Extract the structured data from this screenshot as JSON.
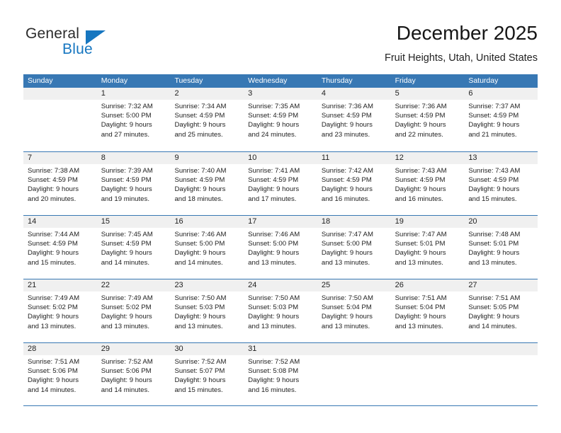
{
  "brand": {
    "name_part1": "General",
    "name_part2": "Blue",
    "accent_color": "#1676c0"
  },
  "header": {
    "title": "December 2025",
    "subtitle": "Fruit Heights, Utah, United States"
  },
  "calendar": {
    "header_color": "#3878b4",
    "weekdays": [
      "Sunday",
      "Monday",
      "Tuesday",
      "Wednesday",
      "Thursday",
      "Friday",
      "Saturday"
    ],
    "weeks": [
      [
        {
          "day": "",
          "sunrise": "",
          "sunset": "",
          "daylight1": "",
          "daylight2": ""
        },
        {
          "day": "1",
          "sunrise": "Sunrise: 7:32 AM",
          "sunset": "Sunset: 5:00 PM",
          "daylight1": "Daylight: 9 hours",
          "daylight2": "and 27 minutes."
        },
        {
          "day": "2",
          "sunrise": "Sunrise: 7:34 AM",
          "sunset": "Sunset: 4:59 PM",
          "daylight1": "Daylight: 9 hours",
          "daylight2": "and 25 minutes."
        },
        {
          "day": "3",
          "sunrise": "Sunrise: 7:35 AM",
          "sunset": "Sunset: 4:59 PM",
          "daylight1": "Daylight: 9 hours",
          "daylight2": "and 24 minutes."
        },
        {
          "day": "4",
          "sunrise": "Sunrise: 7:36 AM",
          "sunset": "Sunset: 4:59 PM",
          "daylight1": "Daylight: 9 hours",
          "daylight2": "and 23 minutes."
        },
        {
          "day": "5",
          "sunrise": "Sunrise: 7:36 AM",
          "sunset": "Sunset: 4:59 PM",
          "daylight1": "Daylight: 9 hours",
          "daylight2": "and 22 minutes."
        },
        {
          "day": "6",
          "sunrise": "Sunrise: 7:37 AM",
          "sunset": "Sunset: 4:59 PM",
          "daylight1": "Daylight: 9 hours",
          "daylight2": "and 21 minutes."
        }
      ],
      [
        {
          "day": "7",
          "sunrise": "Sunrise: 7:38 AM",
          "sunset": "Sunset: 4:59 PM",
          "daylight1": "Daylight: 9 hours",
          "daylight2": "and 20 minutes."
        },
        {
          "day": "8",
          "sunrise": "Sunrise: 7:39 AM",
          "sunset": "Sunset: 4:59 PM",
          "daylight1": "Daylight: 9 hours",
          "daylight2": "and 19 minutes."
        },
        {
          "day": "9",
          "sunrise": "Sunrise: 7:40 AM",
          "sunset": "Sunset: 4:59 PM",
          "daylight1": "Daylight: 9 hours",
          "daylight2": "and 18 minutes."
        },
        {
          "day": "10",
          "sunrise": "Sunrise: 7:41 AM",
          "sunset": "Sunset: 4:59 PM",
          "daylight1": "Daylight: 9 hours",
          "daylight2": "and 17 minutes."
        },
        {
          "day": "11",
          "sunrise": "Sunrise: 7:42 AM",
          "sunset": "Sunset: 4:59 PM",
          "daylight1": "Daylight: 9 hours",
          "daylight2": "and 16 minutes."
        },
        {
          "day": "12",
          "sunrise": "Sunrise: 7:43 AM",
          "sunset": "Sunset: 4:59 PM",
          "daylight1": "Daylight: 9 hours",
          "daylight2": "and 16 minutes."
        },
        {
          "day": "13",
          "sunrise": "Sunrise: 7:43 AM",
          "sunset": "Sunset: 4:59 PM",
          "daylight1": "Daylight: 9 hours",
          "daylight2": "and 15 minutes."
        }
      ],
      [
        {
          "day": "14",
          "sunrise": "Sunrise: 7:44 AM",
          "sunset": "Sunset: 4:59 PM",
          "daylight1": "Daylight: 9 hours",
          "daylight2": "and 15 minutes."
        },
        {
          "day": "15",
          "sunrise": "Sunrise: 7:45 AM",
          "sunset": "Sunset: 4:59 PM",
          "daylight1": "Daylight: 9 hours",
          "daylight2": "and 14 minutes."
        },
        {
          "day": "16",
          "sunrise": "Sunrise: 7:46 AM",
          "sunset": "Sunset: 5:00 PM",
          "daylight1": "Daylight: 9 hours",
          "daylight2": "and 14 minutes."
        },
        {
          "day": "17",
          "sunrise": "Sunrise: 7:46 AM",
          "sunset": "Sunset: 5:00 PM",
          "daylight1": "Daylight: 9 hours",
          "daylight2": "and 13 minutes."
        },
        {
          "day": "18",
          "sunrise": "Sunrise: 7:47 AM",
          "sunset": "Sunset: 5:00 PM",
          "daylight1": "Daylight: 9 hours",
          "daylight2": "and 13 minutes."
        },
        {
          "day": "19",
          "sunrise": "Sunrise: 7:47 AM",
          "sunset": "Sunset: 5:01 PM",
          "daylight1": "Daylight: 9 hours",
          "daylight2": "and 13 minutes."
        },
        {
          "day": "20",
          "sunrise": "Sunrise: 7:48 AM",
          "sunset": "Sunset: 5:01 PM",
          "daylight1": "Daylight: 9 hours",
          "daylight2": "and 13 minutes."
        }
      ],
      [
        {
          "day": "21",
          "sunrise": "Sunrise: 7:49 AM",
          "sunset": "Sunset: 5:02 PM",
          "daylight1": "Daylight: 9 hours",
          "daylight2": "and 13 minutes."
        },
        {
          "day": "22",
          "sunrise": "Sunrise: 7:49 AM",
          "sunset": "Sunset: 5:02 PM",
          "daylight1": "Daylight: 9 hours",
          "daylight2": "and 13 minutes."
        },
        {
          "day": "23",
          "sunrise": "Sunrise: 7:50 AM",
          "sunset": "Sunset: 5:03 PM",
          "daylight1": "Daylight: 9 hours",
          "daylight2": "and 13 minutes."
        },
        {
          "day": "24",
          "sunrise": "Sunrise: 7:50 AM",
          "sunset": "Sunset: 5:03 PM",
          "daylight1": "Daylight: 9 hours",
          "daylight2": "and 13 minutes."
        },
        {
          "day": "25",
          "sunrise": "Sunrise: 7:50 AM",
          "sunset": "Sunset: 5:04 PM",
          "daylight1": "Daylight: 9 hours",
          "daylight2": "and 13 minutes."
        },
        {
          "day": "26",
          "sunrise": "Sunrise: 7:51 AM",
          "sunset": "Sunset: 5:04 PM",
          "daylight1": "Daylight: 9 hours",
          "daylight2": "and 13 minutes."
        },
        {
          "day": "27",
          "sunrise": "Sunrise: 7:51 AM",
          "sunset": "Sunset: 5:05 PM",
          "daylight1": "Daylight: 9 hours",
          "daylight2": "and 14 minutes."
        }
      ],
      [
        {
          "day": "28",
          "sunrise": "Sunrise: 7:51 AM",
          "sunset": "Sunset: 5:06 PM",
          "daylight1": "Daylight: 9 hours",
          "daylight2": "and 14 minutes."
        },
        {
          "day": "29",
          "sunrise": "Sunrise: 7:52 AM",
          "sunset": "Sunset: 5:06 PM",
          "daylight1": "Daylight: 9 hours",
          "daylight2": "and 14 minutes."
        },
        {
          "day": "30",
          "sunrise": "Sunrise: 7:52 AM",
          "sunset": "Sunset: 5:07 PM",
          "daylight1": "Daylight: 9 hours",
          "daylight2": "and 15 minutes."
        },
        {
          "day": "31",
          "sunrise": "Sunrise: 7:52 AM",
          "sunset": "Sunset: 5:08 PM",
          "daylight1": "Daylight: 9 hours",
          "daylight2": "and 16 minutes."
        },
        {
          "day": "",
          "sunrise": "",
          "sunset": "",
          "daylight1": "",
          "daylight2": ""
        },
        {
          "day": "",
          "sunrise": "",
          "sunset": "",
          "daylight1": "",
          "daylight2": ""
        },
        {
          "day": "",
          "sunrise": "",
          "sunset": "",
          "daylight1": "",
          "daylight2": ""
        }
      ]
    ]
  }
}
